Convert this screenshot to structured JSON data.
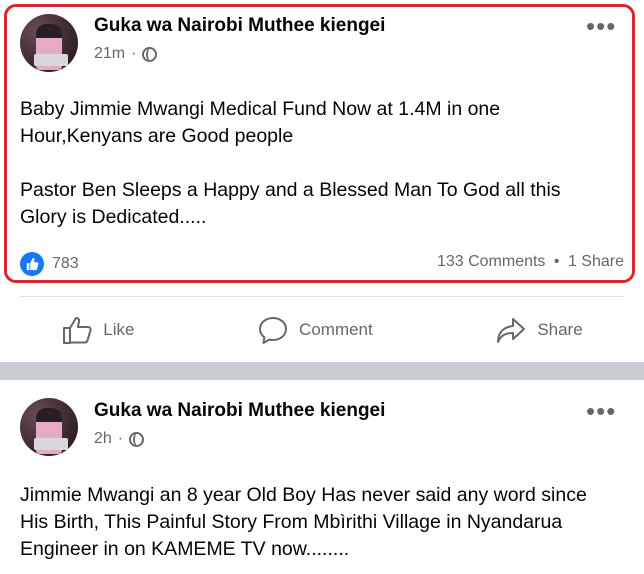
{
  "posts": [
    {
      "author": "Guka wa Nairobi Muthee kiengei",
      "time": "21m",
      "separator": "·",
      "more": "•••",
      "lines": [
        "Baby Jimmie Mwangi Medical Fund Now at 1.4M in one",
        "Hour,Kenyans are Good people",
        "",
        "Pastor Ben Sleeps a Happy and a Blessed Man To God all this",
        "Glory is Dedicated....."
      ],
      "likes": "783",
      "comments": "133 Comments",
      "dot": "•",
      "shares": "1 Share",
      "actions": {
        "like": "Like",
        "comment": "Comment",
        "share": "Share"
      },
      "highlight_color": "#d62833"
    },
    {
      "author": "Guka wa Nairobi Muthee kiengei",
      "time": "2h",
      "separator": "·",
      "more": "•••",
      "lines": [
        "Jimmie Mwangi an 8 year Old Boy Has never said any word since",
        "His Birth, This Painful Story From Mbìrithi Village in Nyandarua",
        "Engineer in on KAMEME TV now........"
      ]
    }
  ],
  "colors": {
    "accent": "#1877f2",
    "muted": "#65676b",
    "feed_bg": "#c9ccd1"
  },
  "icons": [
    "globe-icon",
    "more-options-icon",
    "like-reaction-icon",
    "like-icon",
    "comment-icon",
    "share-icon"
  ]
}
